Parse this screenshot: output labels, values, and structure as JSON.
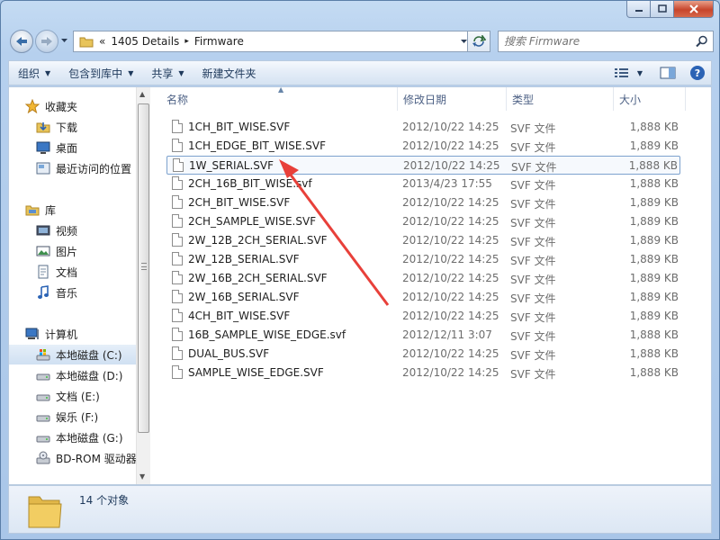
{
  "address": {
    "crumb_prefix": "«",
    "crumbs": [
      "1405 Details",
      "Firmware"
    ],
    "separator": "▸"
  },
  "search": {
    "placeholder": "搜索 Firmware"
  },
  "toolbar": {
    "organize": "组织",
    "include_in_library": "包含到库中",
    "share": "共享",
    "new_folder": "新建文件夹"
  },
  "sidebar": {
    "favorites": "收藏夹",
    "downloads": "下载",
    "desktop": "桌面",
    "recent": "最近访问的位置",
    "libraries": "库",
    "videos": "视频",
    "pictures": "图片",
    "documents": "文档",
    "music": "音乐",
    "computer": "计算机",
    "drive_c": "本地磁盘 (C:)",
    "drive_d": "本地磁盘 (D:)",
    "drive_e": "文档 (E:)",
    "drive_f": "娱乐 (F:)",
    "drive_g": "本地磁盘 (G:)",
    "bdrom": "BD-ROM 驱动器"
  },
  "columns": {
    "name": "名称",
    "date": "修改日期",
    "type": "类型",
    "size": "大小"
  },
  "files": [
    {
      "name": "1CH_BIT_WISE.SVF",
      "date": "2012/10/22 14:25",
      "type": "SVF 文件",
      "size": "1,888 KB"
    },
    {
      "name": "1CH_EDGE_BIT_WISE.SVF",
      "date": "2012/10/22 14:25",
      "type": "SVF 文件",
      "size": "1,889 KB"
    },
    {
      "name": "1W_SERIAL.SVF",
      "date": "2012/10/22 14:25",
      "type": "SVF 文件",
      "size": "1,888 KB"
    },
    {
      "name": "2CH_16B_BIT_WISE.svf",
      "date": "2013/4/23 17:55",
      "type": "SVF 文件",
      "size": "1,888 KB"
    },
    {
      "name": "2CH_BIT_WISE.SVF",
      "date": "2012/10/22 14:25",
      "type": "SVF 文件",
      "size": "1,889 KB"
    },
    {
      "name": "2CH_SAMPLE_WISE.SVF",
      "date": "2012/10/22 14:25",
      "type": "SVF 文件",
      "size": "1,889 KB"
    },
    {
      "name": "2W_12B_2CH_SERIAL.SVF",
      "date": "2012/10/22 14:25",
      "type": "SVF 文件",
      "size": "1,889 KB"
    },
    {
      "name": "2W_12B_SERIAL.SVF",
      "date": "2012/10/22 14:25",
      "type": "SVF 文件",
      "size": "1,889 KB"
    },
    {
      "name": "2W_16B_2CH_SERIAL.SVF",
      "date": "2012/10/22 14:25",
      "type": "SVF 文件",
      "size": "1,889 KB"
    },
    {
      "name": "2W_16B_SERIAL.SVF",
      "date": "2012/10/22 14:25",
      "type": "SVF 文件",
      "size": "1,889 KB"
    },
    {
      "name": "4CH_BIT_WISE.SVF",
      "date": "2012/10/22 14:25",
      "type": "SVF 文件",
      "size": "1,889 KB"
    },
    {
      "name": "16B_SAMPLE_WISE_EDGE.svf",
      "date": "2012/12/11 3:07",
      "type": "SVF 文件",
      "size": "1,888 KB"
    },
    {
      "name": "DUAL_BUS.SVF",
      "date": "2012/10/22 14:25",
      "type": "SVF 文件",
      "size": "1,888 KB"
    },
    {
      "name": "SAMPLE_WISE_EDGE.SVF",
      "date": "2012/10/22 14:25",
      "type": "SVF 文件",
      "size": "1,888 KB"
    }
  ],
  "status": {
    "item_count": "14 个对象"
  },
  "colors": {
    "arrow": "#e8403a",
    "accent": "#1e395b",
    "selection_border": "#7da2ce"
  }
}
